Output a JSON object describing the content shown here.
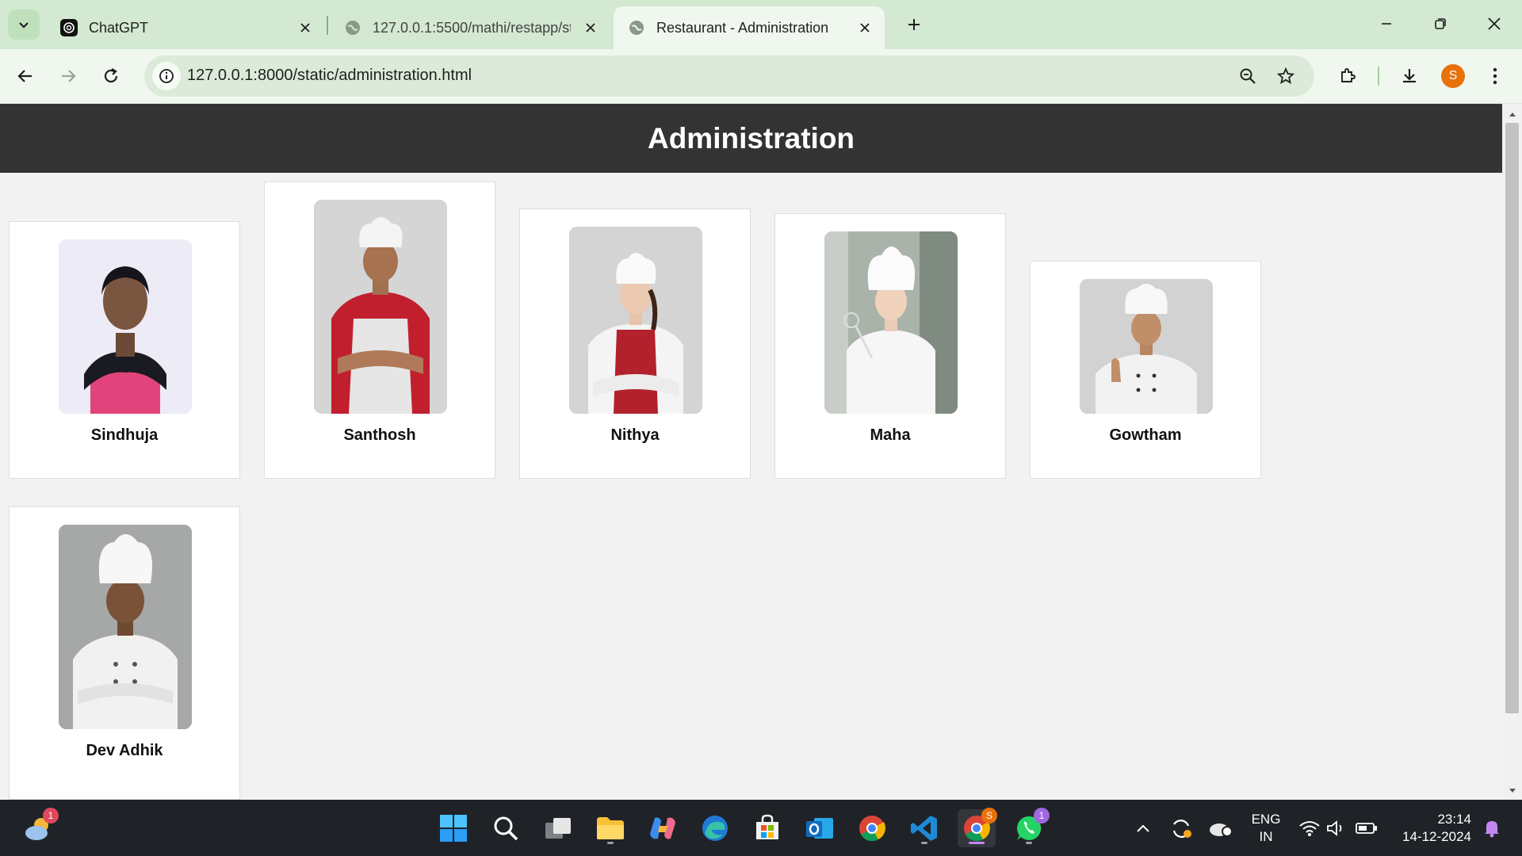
{
  "browser": {
    "tabs": [
      {
        "title": "ChatGPT",
        "active": false
      },
      {
        "title": "127.0.0.1:5500/mathi/restapp/st",
        "active": false
      },
      {
        "title": "Restaurant - Administration",
        "active": true
      }
    ],
    "url": "127.0.0.1:8000/static/administration.html",
    "profile_initial": "S",
    "accent_color": "#d3e9d1",
    "profile_color": "#e8710a"
  },
  "page": {
    "title": "Administration",
    "header_color": "#333333",
    "staff": [
      {
        "name": "Sindhuja"
      },
      {
        "name": "Santhosh"
      },
      {
        "name": "Nithya"
      },
      {
        "name": "Maha"
      },
      {
        "name": "Gowtham"
      },
      {
        "name": "Dev Adhik"
      }
    ]
  },
  "taskbar": {
    "weather_badge": "1",
    "chrome_badge": "S",
    "whatsapp_badge": "1",
    "language": "ENG",
    "region": "IN",
    "time": "23:14",
    "date": "14-12-2024"
  }
}
